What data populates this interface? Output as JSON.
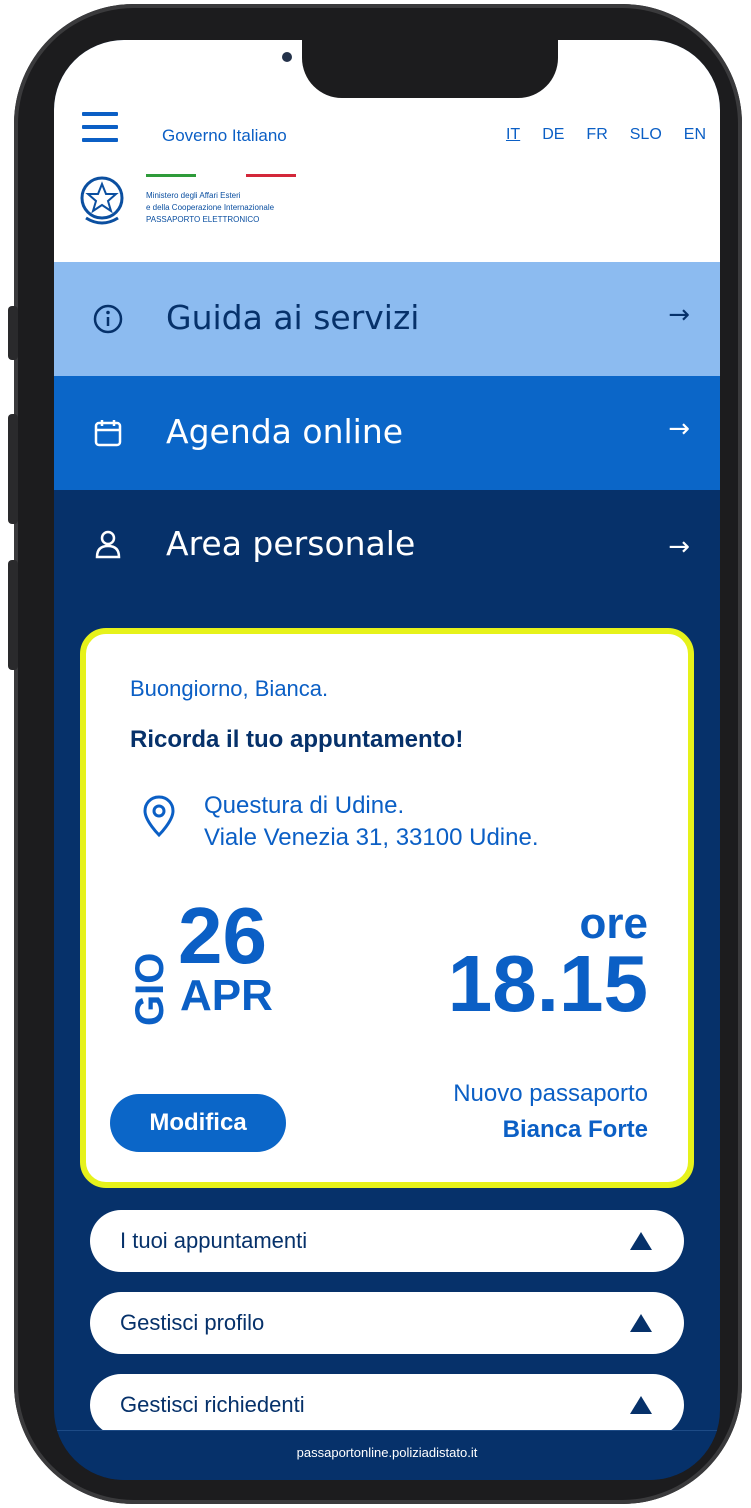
{
  "header": {
    "gov_label": "Governo Italiano",
    "languages": [
      "IT",
      "DE",
      "FR",
      "SLO",
      "EN"
    ],
    "active_language": "IT",
    "ministry_line1": "Ministero degli Affari Esteri",
    "ministry_line2": "e della Cooperazione Internazionale",
    "ministry_line3": "PASSAPORTO ELETTRONICO"
  },
  "menu": {
    "guida": {
      "label": "Guida ai servizi",
      "icon": "info-icon",
      "arrow": "→"
    },
    "agenda": {
      "label": "Agenda online",
      "icon": "calendar-icon",
      "arrow": "→"
    },
    "area": {
      "label": "Area personale",
      "icon": "user-icon",
      "arrow": "→"
    }
  },
  "appointment": {
    "greeting": "Buongiorno, Bianca.",
    "reminder": "Ricorda il tuo appuntamento!",
    "address_line1": "Questura di Udine.",
    "address_line2": "Viale Venezia 31, 33100 Udine.",
    "weekday": "GIO",
    "day": "26",
    "month": "APR",
    "time_prefix": "ore",
    "time": "18.15",
    "edit_label": "Modifica",
    "service": "Nuovo passaporto",
    "person": "Bianca Forte"
  },
  "accordion": [
    {
      "label": "I tuoi appuntamenti"
    },
    {
      "label": "Gestisci profilo"
    },
    {
      "label": "Gestisci richiedenti"
    }
  ],
  "footer": {
    "url": "passaportonline.poliziadistato.it"
  },
  "colors": {
    "primary": "#0b66c8",
    "dark": "#06316a",
    "light": "#8cbbf0",
    "highlight": "#e6f21a"
  }
}
